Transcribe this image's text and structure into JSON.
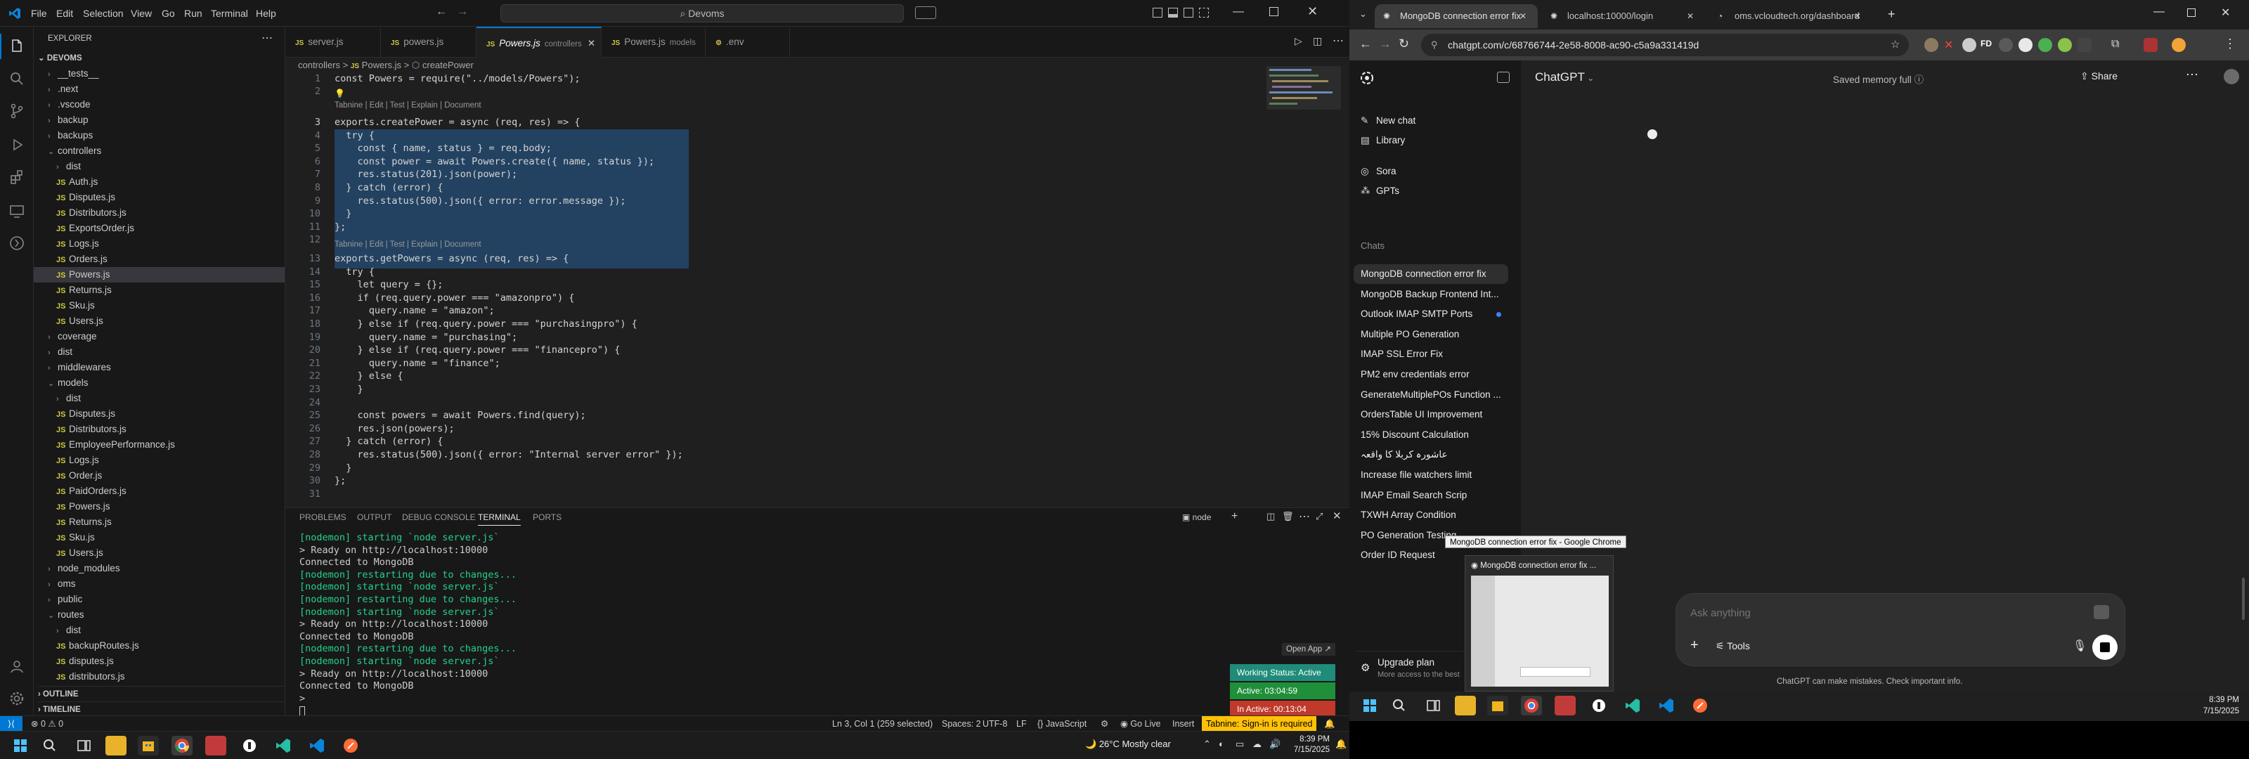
{
  "vscode": {
    "menu": [
      "File",
      "Edit",
      "Selection",
      "View",
      "Go",
      "Run",
      "Terminal",
      "Help"
    ],
    "search": "Devoms",
    "explorer_title": "EXPLORER",
    "project": "DEVOMS",
    "tree": [
      {
        "label": "__tests__",
        "kind": "folder",
        "depth": 1,
        "open": false
      },
      {
        "label": ".next",
        "kind": "folder",
        "depth": 1,
        "open": false
      },
      {
        "label": ".vscode",
        "kind": "folder",
        "depth": 1,
        "open": false
      },
      {
        "label": "backup",
        "kind": "folder",
        "depth": 1,
        "open": false
      },
      {
        "label": "backups",
        "kind": "folder",
        "depth": 1,
        "open": false
      },
      {
        "label": "controllers",
        "kind": "folder",
        "depth": 1,
        "open": true
      },
      {
        "label": "dist",
        "kind": "folder",
        "depth": 2,
        "open": false
      },
      {
        "label": "Auth.js",
        "kind": "file",
        "depth": 2
      },
      {
        "label": "Disputes.js",
        "kind": "file",
        "depth": 2
      },
      {
        "label": "Distributors.js",
        "kind": "file",
        "depth": 2
      },
      {
        "label": "ExportsOrder.js",
        "kind": "file",
        "depth": 2
      },
      {
        "label": "Logs.js",
        "kind": "file",
        "depth": 2
      },
      {
        "label": "Orders.js",
        "kind": "file",
        "depth": 2
      },
      {
        "label": "Powers.js",
        "kind": "file",
        "depth": 2,
        "selected": true
      },
      {
        "label": "Returns.js",
        "kind": "file",
        "depth": 2
      },
      {
        "label": "Sku.js",
        "kind": "file",
        "depth": 2
      },
      {
        "label": "Users.js",
        "kind": "file",
        "depth": 2
      },
      {
        "label": "coverage",
        "kind": "folder",
        "depth": 1,
        "open": false
      },
      {
        "label": "dist",
        "kind": "folder",
        "depth": 1,
        "open": false
      },
      {
        "label": "middlewares",
        "kind": "folder",
        "depth": 1,
        "open": false
      },
      {
        "label": "models",
        "kind": "folder",
        "depth": 1,
        "open": true
      },
      {
        "label": "dist",
        "kind": "folder",
        "depth": 2,
        "open": false
      },
      {
        "label": "Disputes.js",
        "kind": "file",
        "depth": 2
      },
      {
        "label": "Distributors.js",
        "kind": "file",
        "depth": 2
      },
      {
        "label": "EmployeePerformance.js",
        "kind": "file",
        "depth": 2
      },
      {
        "label": "Logs.js",
        "kind": "file",
        "depth": 2
      },
      {
        "label": "Order.js",
        "kind": "file",
        "depth": 2
      },
      {
        "label": "PaidOrders.js",
        "kind": "file",
        "depth": 2
      },
      {
        "label": "Powers.js",
        "kind": "file",
        "depth": 2
      },
      {
        "label": "Returns.js",
        "kind": "file",
        "depth": 2
      },
      {
        "label": "Sku.js",
        "kind": "file",
        "depth": 2
      },
      {
        "label": "Users.js",
        "kind": "file",
        "depth": 2
      },
      {
        "label": "node_modules",
        "kind": "folder",
        "depth": 1,
        "open": false
      },
      {
        "label": "oms",
        "kind": "folder",
        "depth": 1,
        "open": false
      },
      {
        "label": "public",
        "kind": "folder",
        "depth": 1,
        "open": false
      },
      {
        "label": "routes",
        "kind": "folder",
        "depth": 1,
        "open": true
      },
      {
        "label": "dist",
        "kind": "folder",
        "depth": 2,
        "open": false
      },
      {
        "label": "backupRoutes.js",
        "kind": "file",
        "depth": 2
      },
      {
        "label": "disputes.js",
        "kind": "file",
        "depth": 2
      },
      {
        "label": "distributors.js",
        "kind": "file",
        "depth": 2
      }
    ],
    "outline": "OUTLINE",
    "timeline": "TIMELINE",
    "tabs": [
      {
        "name": "server.js",
        "desc": "",
        "active": false
      },
      {
        "name": "powers.js",
        "desc": "",
        "active": false
      },
      {
        "name": "Powers.js",
        "desc": "controllers",
        "active": true
      },
      {
        "name": "Powers.js",
        "desc": "models",
        "active": false
      },
      {
        "name": ".env",
        "desc": "",
        "active": false
      }
    ],
    "breadcrumb": [
      "controllers",
      ">",
      "Powers.js",
      ">",
      "createPower"
    ],
    "code": [
      {
        "n": "1",
        "t": "const Powers = require(\"../models/Powers\");"
      },
      {
        "n": "2",
        "t": ""
      },
      {
        "n": "3",
        "t": "exports.createPower = async (req, res) => {"
      },
      {
        "n": "4",
        "t": "  try {"
      },
      {
        "n": "5",
        "t": "    const { name, status } = req.body;"
      },
      {
        "n": "6",
        "t": "    const power = await Powers.create({ name, status });"
      },
      {
        "n": "7",
        "t": "    res.status(201).json(power);"
      },
      {
        "n": "8",
        "t": "  } catch (error) {"
      },
      {
        "n": "9",
        "t": "    res.status(500).json({ error: error.message });"
      },
      {
        "n": "10",
        "t": "  }"
      },
      {
        "n": "11",
        "t": "};"
      },
      {
        "n": "12",
        "t": ""
      },
      {
        "n": "13",
        "t": "exports.getPowers = async (req, res) => {"
      },
      {
        "n": "14",
        "t": "  try {"
      },
      {
        "n": "15",
        "t": "    let query = {};"
      },
      {
        "n": "16",
        "t": "    if (req.query.power === \"amazonpro\") {"
      },
      {
        "n": "17",
        "t": "      query.name = \"amazon\";"
      },
      {
        "n": "18",
        "t": "    } else if (req.query.power === \"purchasingpro\") {"
      },
      {
        "n": "19",
        "t": "      query.name = \"purchasing\";"
      },
      {
        "n": "20",
        "t": "    } else if (req.query.power === \"financepro\") {"
      },
      {
        "n": "21",
        "t": "      query.name = \"finance\";"
      },
      {
        "n": "22",
        "t": "    } else {"
      },
      {
        "n": "23",
        "t": "    }"
      },
      {
        "n": "24",
        "t": ""
      },
      {
        "n": "25",
        "t": "    const powers = await Powers.find(query);"
      },
      {
        "n": "26",
        "t": "    res.json(powers);"
      },
      {
        "n": "27",
        "t": "  } catch (error) {"
      },
      {
        "n": "28",
        "t": "    res.status(500).json({ error: \"Internal server error\" });"
      },
      {
        "n": "29",
        "t": "  }"
      },
      {
        "n": "30",
        "t": "};"
      },
      {
        "n": "31",
        "t": ""
      }
    ],
    "codelens": "Tabnine | Edit | Test | Explain | Document",
    "panel_tabs": [
      "PROBLEMS",
      "OUTPUT",
      "DEBUG CONSOLE",
      "TERMINAL",
      "PORTS"
    ],
    "terminal_name": "node",
    "terminal": [
      {
        "t": "[nodemon] starting `node server.js`",
        "c": "green"
      },
      {
        "t": "> Ready on http://localhost:10000",
        "c": ""
      },
      {
        "t": "Connected to MongoDB",
        "c": ""
      },
      {
        "t": "[nodemon] restarting due to changes...",
        "c": "green"
      },
      {
        "t": "[nodemon] starting `node server.js`",
        "c": "green"
      },
      {
        "t": "[nodemon] restarting due to changes...",
        "c": "green"
      },
      {
        "t": "[nodemon] starting `node server.js`",
        "c": "green"
      },
      {
        "t": "> Ready on http://localhost:10000",
        "c": ""
      },
      {
        "t": "Connected to MongoDB",
        "c": ""
      },
      {
        "t": "[nodemon] restarting due to changes...",
        "c": "green"
      },
      {
        "t": "[nodemon] starting `node server.js`",
        "c": "green"
      },
      {
        "t": "> Ready on http://localhost:10000",
        "c": ""
      },
      {
        "t": "Connected to MongoDB",
        "c": ""
      },
      {
        "t": ">",
        "c": ""
      }
    ],
    "open_app": "Open App ↗",
    "working_status": "Working Status: Active",
    "active_time": "Active: 03:04:59",
    "inactive_time": "In Active: 00:13:04",
    "status": {
      "errors": "0",
      "warnings": "0",
      "cursor": "Ln 3, Col 1 (259 selected)",
      "spaces": "Spaces: 2",
      "encoding": "UTF-8",
      "eol": "LF",
      "lang": "{} JavaScript",
      "golive": "Go Live",
      "mode": "Insert",
      "tabnine": "Tabnine: Sign-in is required"
    },
    "weather": "26°C  Mostly clear",
    "time": "8:39 PM",
    "date": "7/15/2025"
  },
  "chrome": {
    "tabs": [
      {
        "title": "MongoDB connection error fix",
        "active": true
      },
      {
        "title": "localhost:10000/login",
        "active": false
      },
      {
        "title": "oms.vcloudtech.org/dashboard",
        "active": false
      }
    ],
    "url": "chatgpt.com/c/68766744-2e58-8008-ac90-c5a9a331419d",
    "app_title": "ChatGPT",
    "memory": "Saved memory full",
    "share": "Share",
    "nav": [
      {
        "label": "New chat",
        "icon": "edit-icon"
      },
      {
        "label": "Library",
        "icon": "library-icon"
      },
      {
        "label": "Sora",
        "icon": "sora-icon"
      },
      {
        "label": "GPTs",
        "icon": "gpts-icon"
      }
    ],
    "chats_header": "Chats",
    "chats": [
      {
        "label": "MongoDB connection error fix",
        "sel": true
      },
      {
        "label": "MongoDB Backup Frontend Int..."
      },
      {
        "label": "Outlook IMAP SMTP Ports",
        "dot": true
      },
      {
        "label": "Multiple PO Generation"
      },
      {
        "label": "IMAP SSL Error Fix"
      },
      {
        "label": "PM2 env credentials error"
      },
      {
        "label": "GenerateMultiplePOs Function ..."
      },
      {
        "label": "OrdersTable UI Improvement"
      },
      {
        "label": "15% Discount Calculation"
      },
      {
        "label": "عاشورہ کربلا کا واقعہ"
      },
      {
        "label": "Increase file watchers limit"
      },
      {
        "label": "IMAP Email Search Scrip"
      },
      {
        "label": "TXWH Array Condition"
      },
      {
        "label": "PO Generation Testing"
      },
      {
        "label": "Order ID Request"
      }
    ],
    "upgrade": "Upgrade plan",
    "upgrade_sub": "More access to the best",
    "tooltip": "MongoDB connection error fix - Google Chrome",
    "thumb_title": "MongoDB connection error fix ...",
    "placeholder": "Ask anything",
    "tools": "Tools",
    "disclaimer": "ChatGPT can make mistakes. Check important info.",
    "time": "8:39 PM",
    "date": "7/15/2025"
  }
}
